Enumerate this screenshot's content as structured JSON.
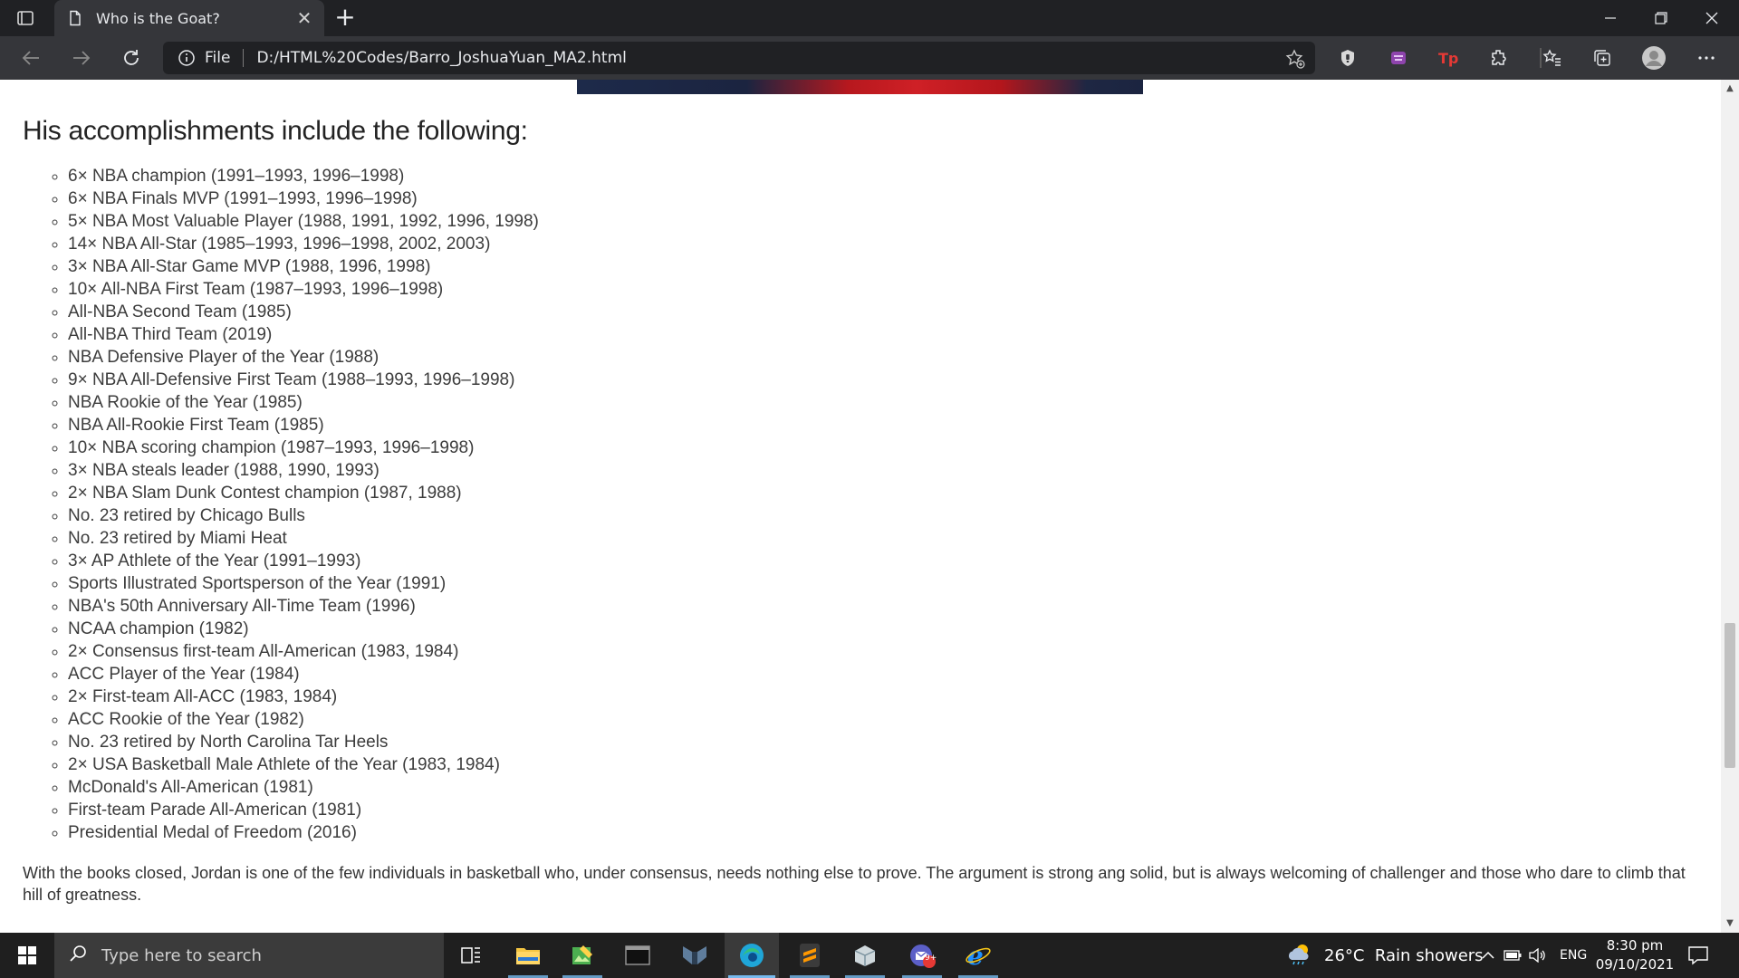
{
  "browser": {
    "tab_title": "Who is the Goat?",
    "tab_close": "✕",
    "new_tab": "+",
    "address_scheme": "File",
    "address_url": "D:/HTML%20Codes/Barro_JoshuaYuan_MA2.html",
    "window_controls": {
      "minimize": "—",
      "maximize": "❐",
      "close": "✕"
    }
  },
  "page": {
    "heading": "His accomplishments include the following:",
    "accomplishments": [
      "6× NBA champion (1991–1993, 1996–1998)",
      "6× NBA Finals MVP (1991–1993, 1996–1998)",
      "5× NBA Most Valuable Player (1988, 1991, 1992, 1996, 1998)",
      "14× NBA All-Star (1985–1993, 1996–1998, 2002, 2003)",
      "3× NBA All-Star Game MVP (1988, 1996, 1998)",
      "10× All-NBA First Team (1987–1993, 1996–1998)",
      "All-NBA Second Team (1985)",
      "All-NBA Third Team (2019)",
      "NBA Defensive Player of the Year (1988)",
      "9× NBA All-Defensive First Team (1988–1993, 1996–1998)",
      "NBA Rookie of the Year (1985)",
      "NBA All-Rookie First Team (1985)",
      "10× NBA scoring champion (1987–1993, 1996–1998)",
      "3× NBA steals leader (1988, 1990, 1993)",
      "2× NBA Slam Dunk Contest champion (1987, 1988)",
      "No. 23 retired by Chicago Bulls",
      "No. 23 retired by Miami Heat",
      "3× AP Athlete of the Year (1991–1993)",
      "Sports Illustrated Sportsperson of the Year (1991)",
      "NBA's 50th Anniversary All-Time Team (1996)",
      "NCAA champion (1982)",
      "2× Consensus first-team All-American (1983, 1984)",
      "ACC Player of the Year (1984)",
      "2× First-team All-ACC (1983, 1984)",
      "ACC Rookie of the Year (1982)",
      "No. 23 retired by North Carolina Tar Heels",
      "2× USA Basketball Male Athlete of the Year (1983, 1984)",
      "McDonald's All-American (1981)",
      "First-team Parade All-American (1981)",
      "Presidential Medal of Freedom (2016)"
    ],
    "closing_paragraph": "With the books closed, Jordan is one of the few individuals in basketball who, under consensus, needs nothing else to prove. The argument is strong ang solid, but is always welcoming of challenger and those who dare to climb that hill of greatness."
  },
  "taskbar": {
    "search_placeholder": "Type here to search",
    "weather": "26°C  Rain showers",
    "language": "ENG",
    "time": "8:30 pm",
    "date": "09/10/2021",
    "mail_badge": "9+"
  },
  "colors": {
    "tab_strip": "#202124",
    "toolbar": "#35363a",
    "taskbar": "#1f1f1f",
    "accent": "#76b9ed"
  }
}
